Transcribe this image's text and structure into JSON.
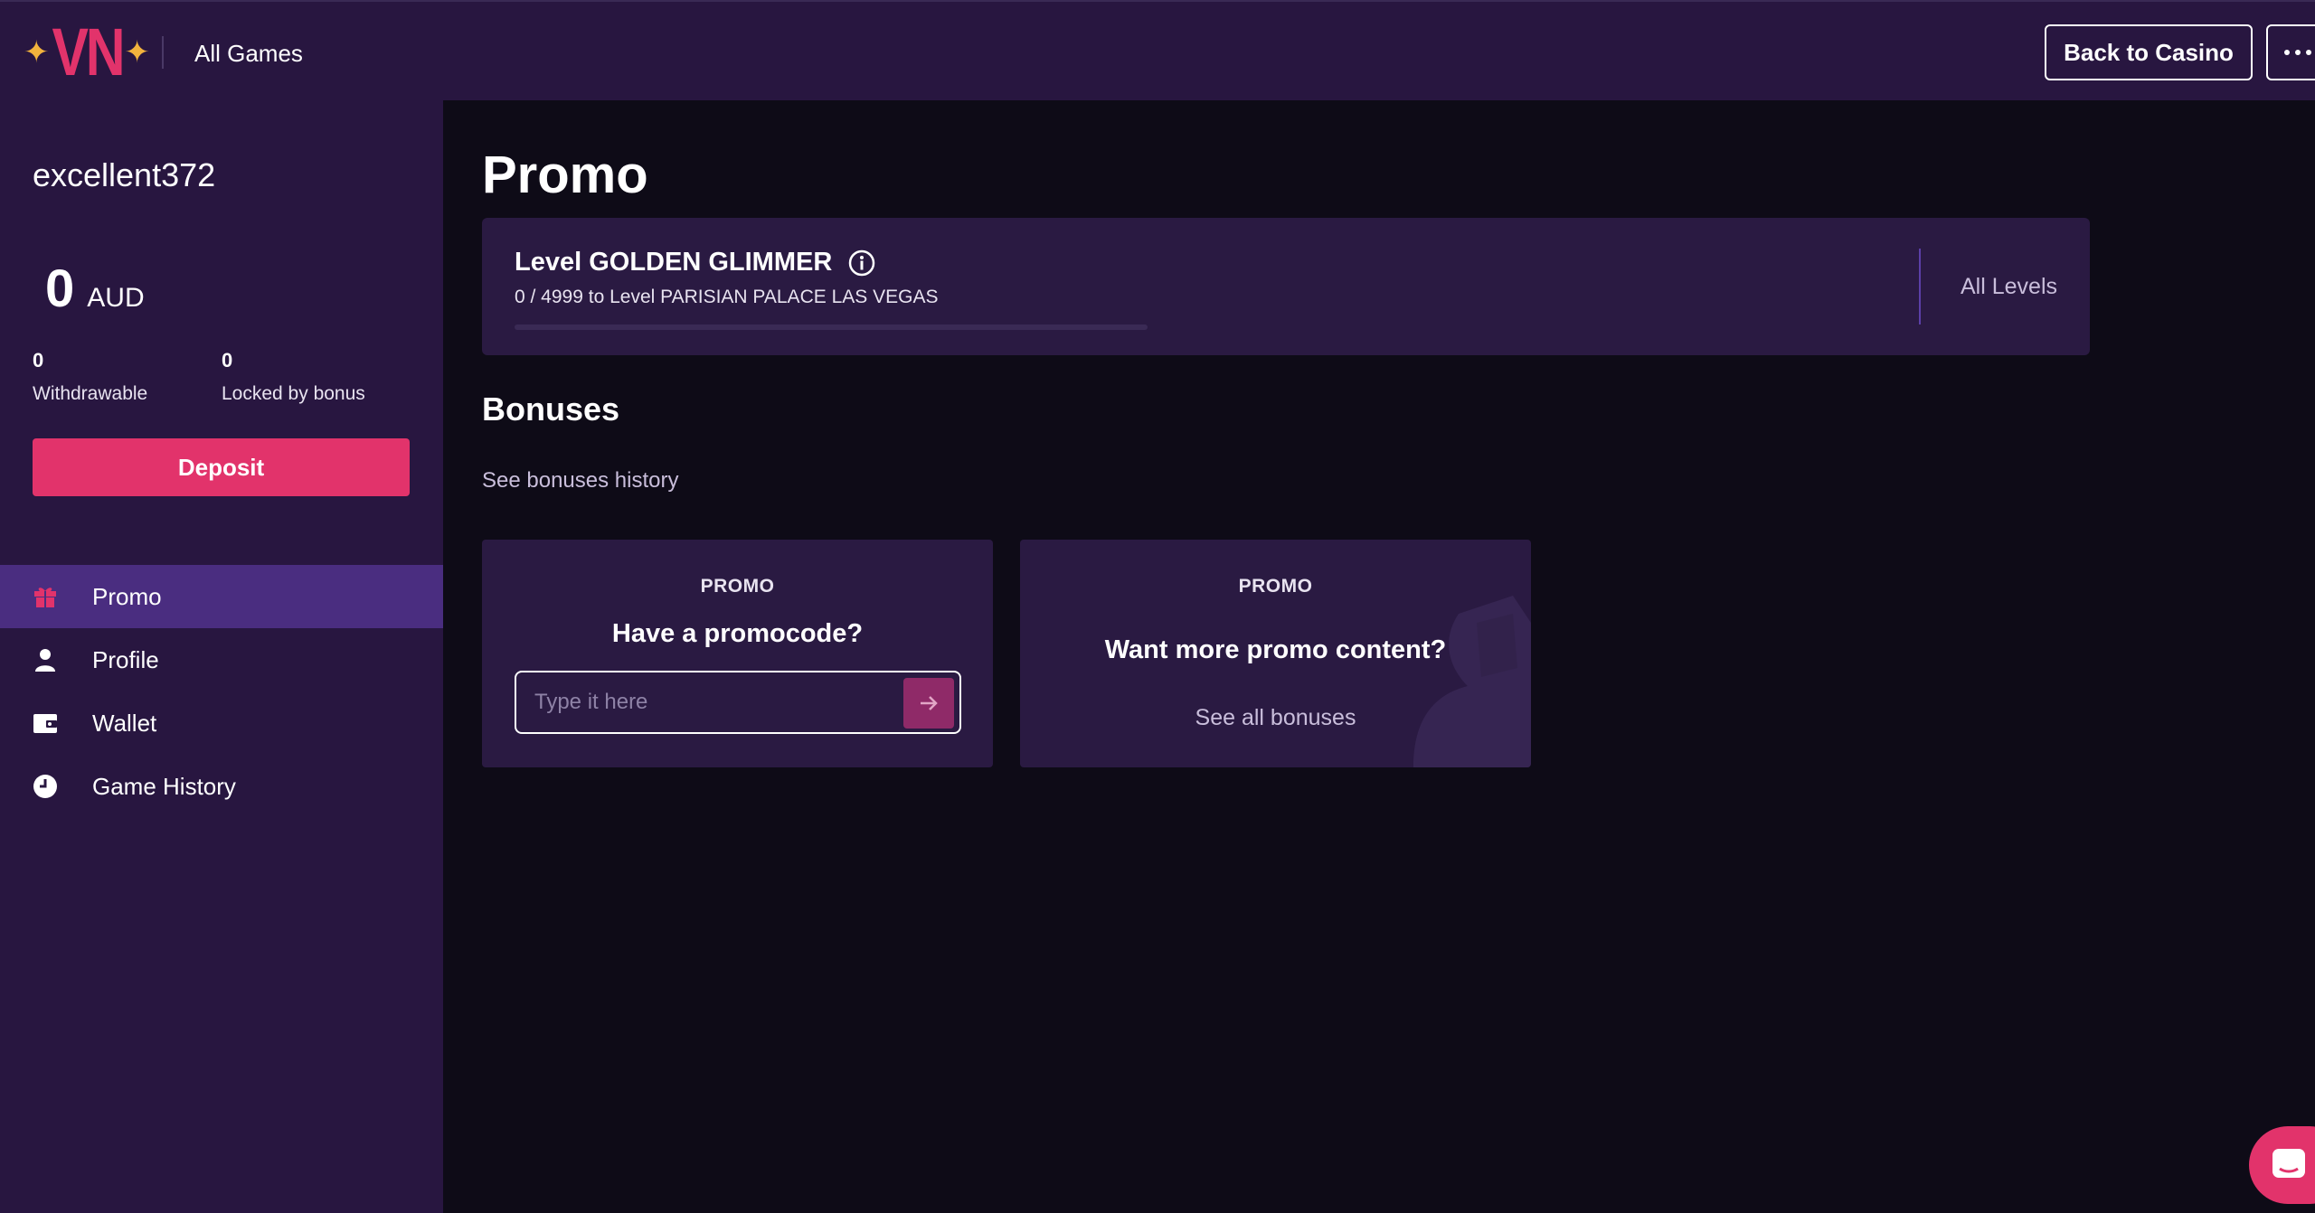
{
  "header": {
    "logo_text": "VN",
    "all_games": "All Games",
    "back_to_casino": "Back to Casino"
  },
  "sidebar": {
    "username": "excellent372",
    "balance": {
      "amount": "0",
      "currency": "AUD"
    },
    "withdrawable": {
      "value": "0",
      "label": "Withdrawable"
    },
    "locked": {
      "value": "0",
      "label": "Locked by bonus"
    },
    "deposit_label": "Deposit",
    "nav": [
      {
        "label": "Promo",
        "icon": "gift-icon",
        "active": true
      },
      {
        "label": "Profile",
        "icon": "person-icon",
        "active": false
      },
      {
        "label": "Wallet",
        "icon": "wallet-icon",
        "active": false
      },
      {
        "label": "Game History",
        "icon": "clock-icon",
        "active": false
      }
    ]
  },
  "main": {
    "title": "Promo",
    "level": {
      "name": "Level GOLDEN GLIMMER",
      "progress_text": "0 / 4999 to Level PARISIAN PALACE LAS VEGAS",
      "progress_fraction": 0.0,
      "all_levels": "All Levels"
    },
    "bonuses": {
      "title": "Bonuses",
      "history_link": "See bonuses history"
    },
    "cards": [
      {
        "label": "PROMO",
        "question": "Have a promocode?",
        "input_placeholder": "Type it here"
      },
      {
        "label": "PROMO",
        "question": "Want more promo content?",
        "link": "See all bonuses"
      }
    ]
  },
  "colors": {
    "accent": "#e2336b",
    "panel": "#281640",
    "card": "#2a1a42",
    "active_nav": "#4a2d80",
    "background": "#0e0b17",
    "star": "#f2b33d"
  }
}
